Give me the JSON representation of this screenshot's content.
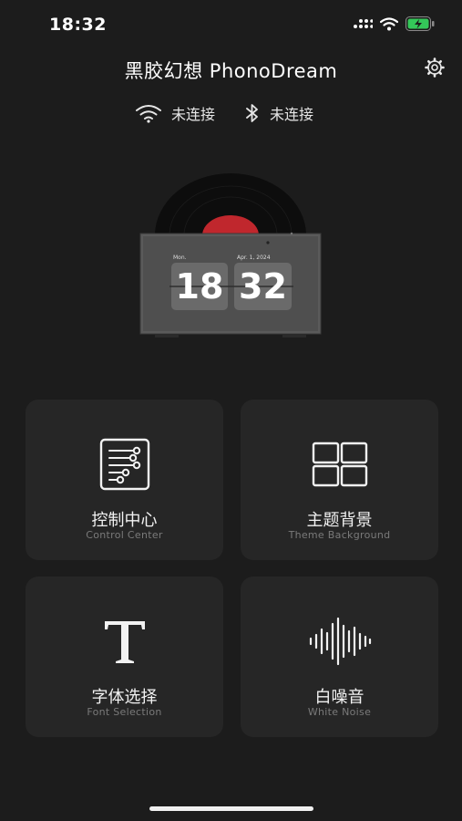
{
  "status_bar": {
    "time": "18:32"
  },
  "header": {
    "title": "黑胶幻想 PhonoDream"
  },
  "connection": {
    "wifi_status": "未连接",
    "bluetooth_status": "未连接"
  },
  "clock_widget": {
    "day_label": "Mon.",
    "date_label": "Apr. 1, 2024",
    "hour": "18",
    "minute": "32"
  },
  "tiles": [
    {
      "label": "控制中心",
      "sub": "Control Center"
    },
    {
      "label": "主题背景",
      "sub": "Theme Background"
    },
    {
      "label": "字体选择",
      "sub": "Font Selection"
    },
    {
      "label": "白噪音",
      "sub": "White Noise"
    }
  ],
  "colors": {
    "background": "#1c1c1c",
    "tile": "#262626",
    "record_label": "#c0272d",
    "battery": "#34c759"
  }
}
